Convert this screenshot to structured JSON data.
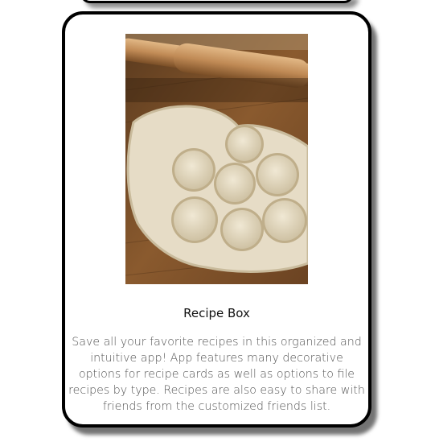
{
  "project_card": {
    "title": "Recipe Box",
    "description": "Save all your favorite recipes in this organized and intuitive app! App features many decorative options for recipe cards as well as options to file recipes by type. Recipes are also easy to share with friends from the customized friends list.",
    "image_subject": "rolled dough with cut-out biscuit rounds and a rolling pin on a wooden board"
  },
  "colors": {
    "card_border": "#000000",
    "card_background": "#ffffff",
    "title_text": "#111111",
    "description_text": "#555555",
    "wood": "#8a5a2e",
    "dough": "#e6dcc6"
  }
}
